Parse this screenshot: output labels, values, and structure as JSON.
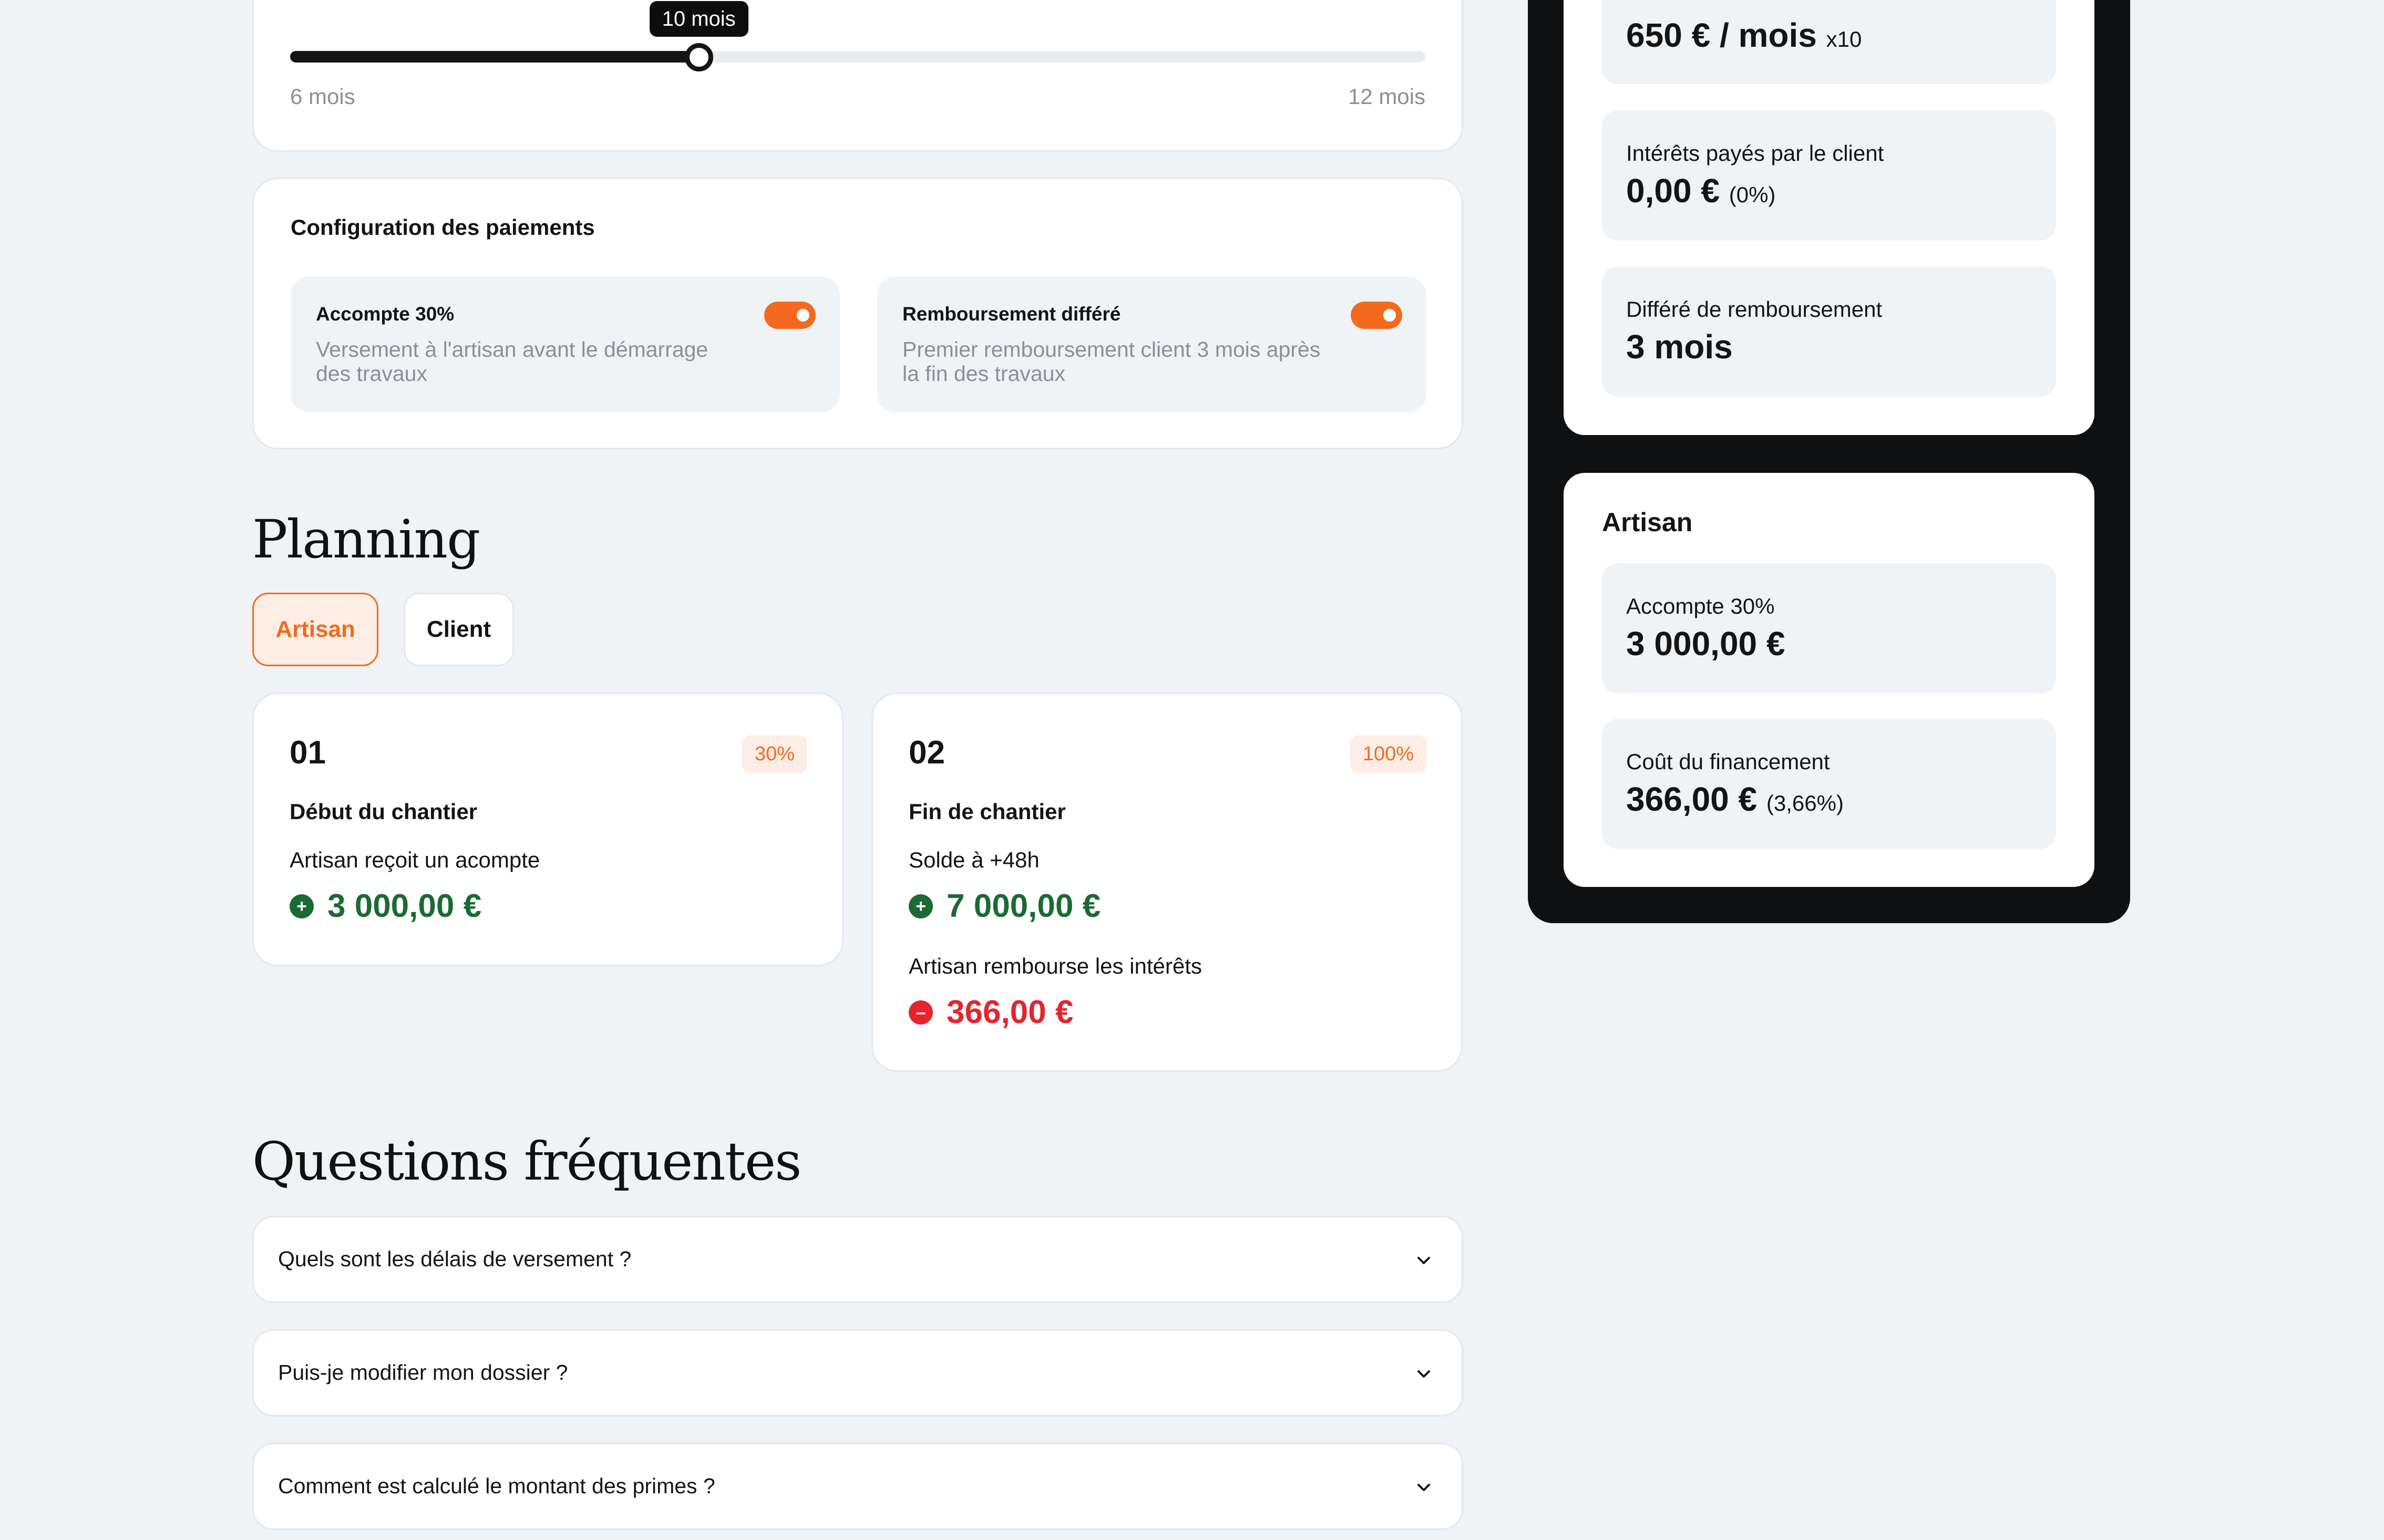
{
  "slider": {
    "min_label": "6 mois",
    "max_label": "12 mois",
    "value_label": "10 mois",
    "fraction": 0.36
  },
  "payments": {
    "title": "Configuration des paiements",
    "options": [
      {
        "title": "Accompte 30%",
        "description": "Versement à l'artisan avant le démarrage des travaux",
        "enabled": true
      },
      {
        "title": "Remboursement différé",
        "description": "Premier remboursement client 3 mois après la fin des travaux",
        "enabled": true
      }
    ]
  },
  "planning": {
    "heading": "Planning",
    "tabs": [
      {
        "label": "Artisan",
        "active": true
      },
      {
        "label": "Client",
        "active": false
      }
    ],
    "steps": [
      {
        "number": "01",
        "badge": "30%",
        "title": "Début du chantier",
        "entries": [
          {
            "label": "Artisan reçoit un acompte",
            "amount": "3 000,00 €",
            "sign": "+"
          }
        ]
      },
      {
        "number": "02",
        "badge": "100%",
        "title": "Fin de chantier",
        "entries": [
          {
            "label": "Solde à +48h",
            "amount": "7 000,00 €",
            "sign": "+"
          },
          {
            "label": "Artisan rembourse les intérêts",
            "amount": "366,00 €",
            "sign": "-"
          }
        ]
      }
    ]
  },
  "faq": {
    "heading": "Questions fréquentes",
    "items": [
      {
        "question": "Quels sont les délais de versement ?"
      },
      {
        "question": "Puis-je modifier mon dossier ?"
      },
      {
        "question": "Comment est calculé le montant des primes ?"
      }
    ]
  },
  "summary": {
    "client_stats": [
      {
        "label": "",
        "value": "650 € / mois",
        "sub": "x10"
      },
      {
        "label": "Intérêts payés par le client",
        "value": "0,00 €",
        "sub": "(0%)"
      },
      {
        "label": "Différé de remboursement",
        "value": "3 mois",
        "sub": ""
      }
    ],
    "artisan": {
      "title": "Artisan",
      "stats": [
        {
          "label": "Accompte 30%",
          "value": "3 000,00 €",
          "sub": ""
        },
        {
          "label": "Coût du financement",
          "value": "366,00 €",
          "sub": "(3,66%)"
        }
      ]
    }
  },
  "icons": {
    "plus": "plus-circle-icon",
    "minus": "minus-circle-icon",
    "chevron": "chevron-down-icon"
  },
  "colors": {
    "accent": "#f36a1f",
    "positive": "#1b6a33",
    "negative": "#e5242e",
    "panel_dark": "#0f1012",
    "background": "#f0f3f6"
  }
}
